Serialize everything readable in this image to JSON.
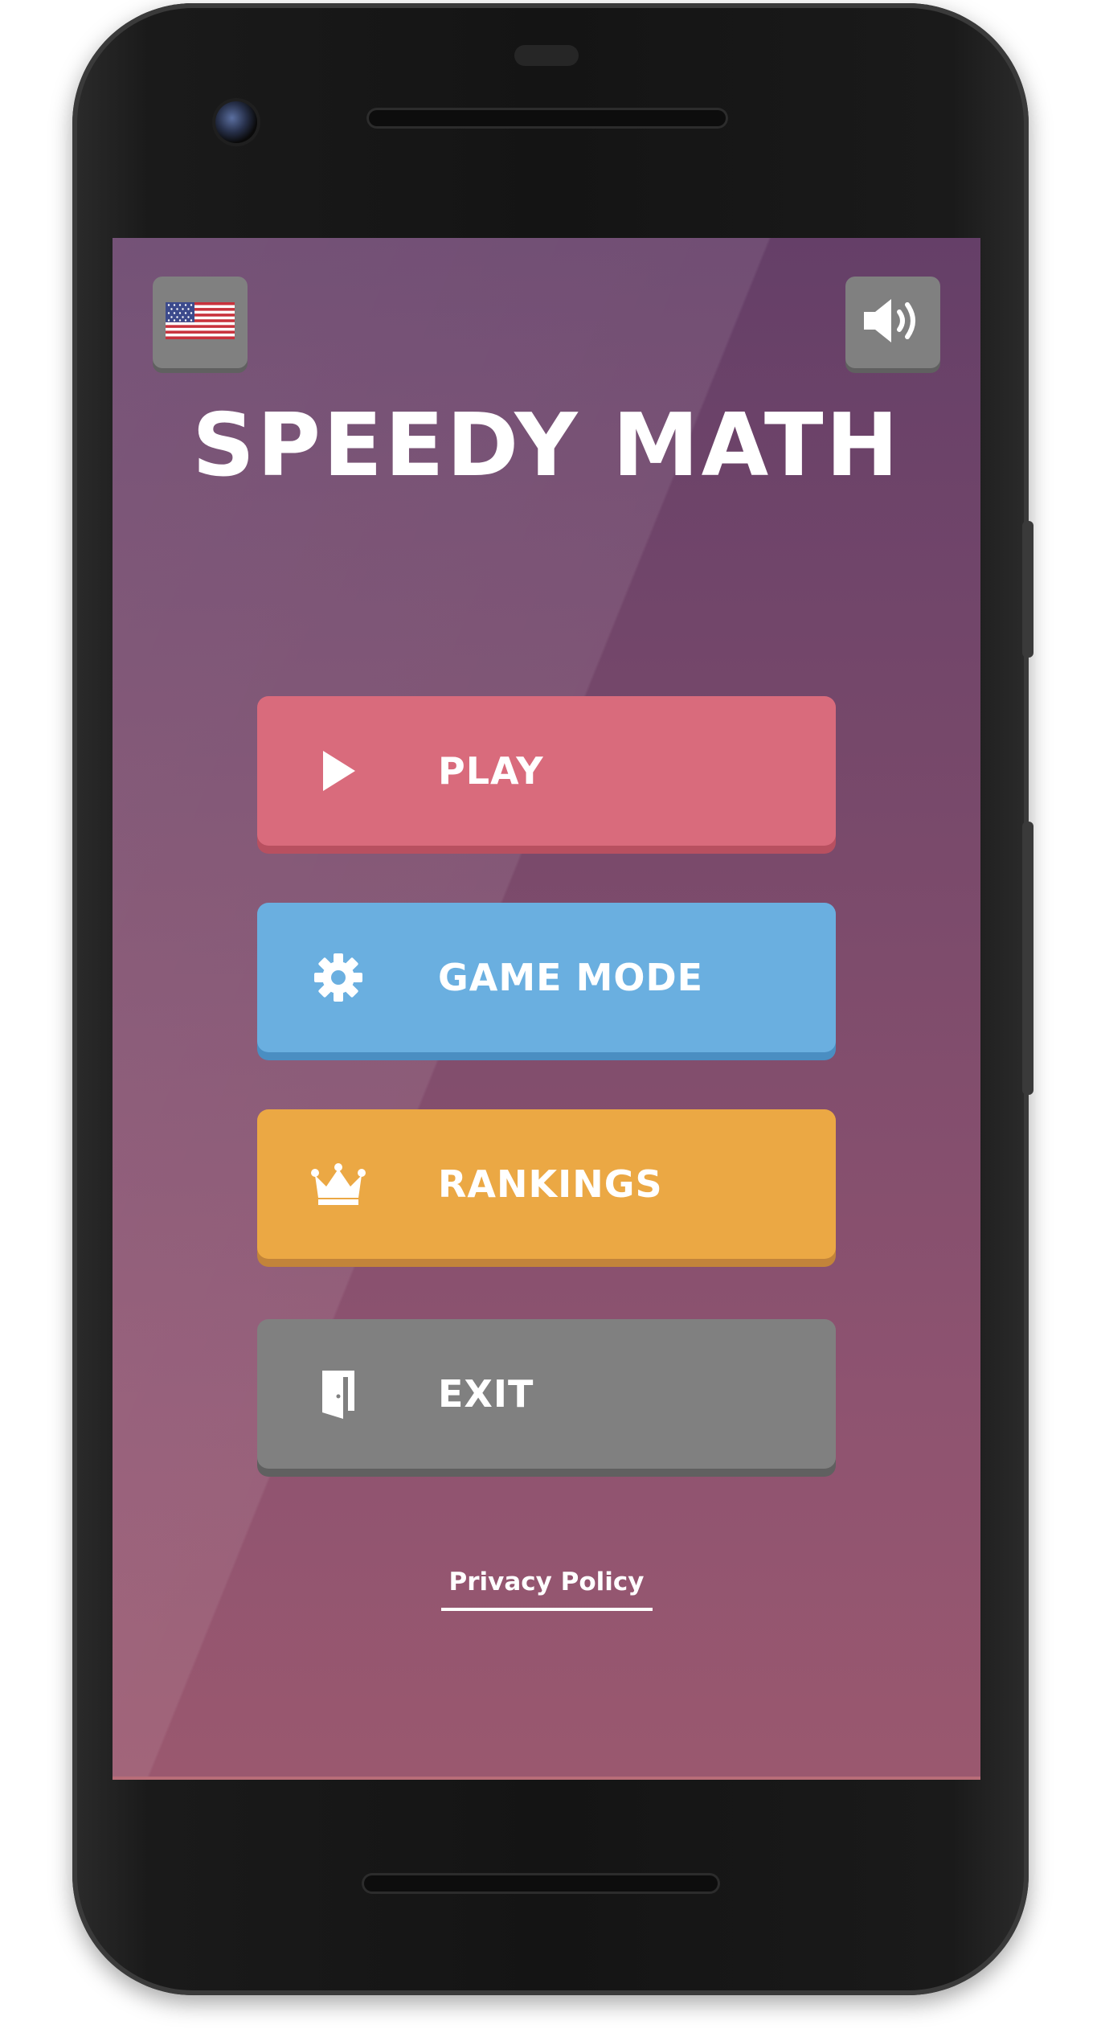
{
  "app": {
    "title": "SPEEDY MATH"
  },
  "top_bar": {
    "language_icon": "us-flag-icon",
    "sound_icon": "speaker-volume-icon"
  },
  "menu": {
    "items": [
      {
        "label": "PLAY",
        "icon": "play-icon",
        "color": "#d96b7c"
      },
      {
        "label": "GAME MODE",
        "icon": "gear-icon",
        "color": "#6aafe0"
      },
      {
        "label": "RANKINGS",
        "icon": "crown-icon",
        "color": "#eba844"
      },
      {
        "label": "EXIT",
        "icon": "exit-door-icon",
        "color": "#808080"
      }
    ]
  },
  "footer": {
    "privacy_label": "Privacy Policy"
  },
  "colors": {
    "background_top": "#653f68",
    "background_bottom": "#9a586f",
    "text": "#ffffff"
  }
}
